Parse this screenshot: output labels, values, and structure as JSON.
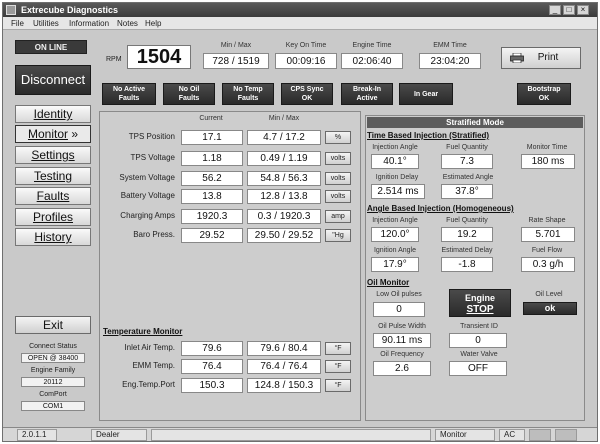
{
  "window": {
    "title": "Extrecube Diagnostics"
  },
  "menu": [
    "File",
    "Utilities",
    "Information",
    "Notes",
    "Help"
  ],
  "sidebar": {
    "online_label": "ON LINE",
    "disconnect_label": "Disconnect",
    "nav": [
      {
        "label": "Identity",
        "active": false
      },
      {
        "label": "Monitor",
        "active": true
      },
      {
        "label": "Settings",
        "active": false
      },
      {
        "label": "Testing",
        "active": false
      },
      {
        "label": "Faults",
        "active": false
      },
      {
        "label": "Profiles",
        "active": false
      },
      {
        "label": "History",
        "active": false
      }
    ],
    "exit_label": "Exit",
    "connect_status_label": "Connect Status",
    "connect_status_value": "OPEN @ 38400",
    "engine_family_label": "Engine Family",
    "engine_family_value": "20112",
    "comport_label": "ComPort",
    "comport_value": "COM1"
  },
  "header": {
    "rpm_label": "RPM",
    "rpm_value": "1504",
    "minmax_label": "Min / Max",
    "minmax_value": "728 / 1519",
    "key_on_label": "Key On Time",
    "key_on_value": "00:09:16",
    "engine_time_label": "Engine Time",
    "engine_time_value": "02:06:40",
    "emm_time_label": "EMM Time",
    "emm_time_value": "23:04:20",
    "print_label": "Print"
  },
  "status_buttons": [
    {
      "line1": "No Active",
      "line2": "Faults"
    },
    {
      "line1": "No Oil",
      "line2": "Faults"
    },
    {
      "line1": "No Temp",
      "line2": "Faults"
    },
    {
      "line1": "CPS Sync",
      "line2": "OK"
    },
    {
      "line1": "Break-In",
      "line2": "Active"
    },
    {
      "line1": "In Gear",
      "line2": ""
    },
    {
      "line1": "Bootstrap",
      "line2": "OK"
    }
  ],
  "monitor": {
    "col_current": "Current",
    "col_minmax": "Min / Max",
    "rows": [
      {
        "label": "TPS Position",
        "current": "17.1",
        "minmax": "4.7 / 17.2",
        "unit": "%"
      },
      {
        "label": "TPS Voltage",
        "current": "1.18",
        "minmax": "0.49 / 1.19",
        "unit": "volts"
      },
      {
        "label": "System Voltage",
        "current": "56.2",
        "minmax": "54.8 / 56.3",
        "unit": "volts"
      },
      {
        "label": "Battery Voltage",
        "current": "13.8",
        "minmax": "12.8 / 13.8",
        "unit": "volts"
      },
      {
        "label": "Charging Amps",
        "current": "1920.3",
        "minmax": "0.3 / 1920.3",
        "unit": "amp"
      },
      {
        "label": "Baro Press.",
        "current": "29.52",
        "minmax": "29.50 / 29.52",
        "unit": "\"Hg"
      }
    ]
  },
  "temperature": {
    "title": "Temperature Monitor",
    "rows": [
      {
        "label": "Inlet Air Temp.",
        "current": "79.6",
        "minmax": "79.6 / 80.4",
        "unit": "°F"
      },
      {
        "label": "EMM Temp.",
        "current": "76.4",
        "minmax": "76.4 / 76.4",
        "unit": "°F"
      },
      {
        "label": "Eng.Temp.Port",
        "current": "150.3",
        "minmax": "124.8 / 150.3",
        "unit": "°F"
      }
    ]
  },
  "stratified": {
    "header": "Stratified Mode",
    "tbi_title": "Time Based Injection (Stratified)",
    "tbi": [
      {
        "label": "Injection Angle",
        "value": "40.1°"
      },
      {
        "label": "Fuel Quantity",
        "value": "7.3"
      },
      {
        "label": "Monitor Time",
        "value": "180 ms"
      },
      {
        "label": "Ignition Delay",
        "value": "2.514 ms"
      },
      {
        "label": "Estimated Angle",
        "value": "37.8°"
      }
    ],
    "abi_title": "Angle Based Injection (Homogeneous)",
    "abi": [
      {
        "label": "Injection Angle",
        "value": "120.0°"
      },
      {
        "label": "Fuel Quantity",
        "value": "19.2"
      },
      {
        "label": "Rate Shape",
        "value": "5.701"
      },
      {
        "label": "Ignition Angle",
        "value": "17.9°"
      },
      {
        "label": "Estimated Delay",
        "value": "-1.8"
      },
      {
        "label": "Fuel Flow",
        "value": "0.3 g/h"
      }
    ],
    "oil_title": "Oil Monitor",
    "low_oil_label": "Low Oil pulses",
    "low_oil_value": "0",
    "engine_stop_line1": "Engine",
    "engine_stop_line2": "STOP",
    "oil_level_label": "Oil Level",
    "oil_level_value": "ok",
    "oil_pulse_width_label": "Oil Pulse Width",
    "oil_pulse_width_value": "90.11 ms",
    "transient_label": "Transient ID",
    "transient_value": "0",
    "oil_freq_label": "Oil Frequency",
    "oil_freq_value": "2.6",
    "water_valve_label": "Water Valve",
    "water_valve_value": "OFF"
  },
  "statusbar": {
    "version": "2.0.1.1",
    "user": "Dealer",
    "mode": "Monitor",
    "power": "AC"
  },
  "colors": {
    "dark_button": "#2f2f2f",
    "panel": "#cdcdcd",
    "title_bar": "#4a4a4a"
  }
}
